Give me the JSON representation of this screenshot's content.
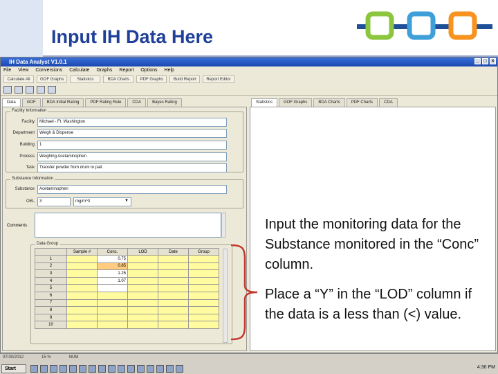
{
  "slide": {
    "title": "Input IH Data Here",
    "callout_1": "Input the monitoring data for the Substance monitored in the “Conc” column.",
    "callout_2": "Place a “Y” in the “LOD” column if the data is a less than (<) value."
  },
  "colors": {
    "title": "#1f3f99",
    "logo_green": "#8cc63f",
    "logo_blue": "#3f9fd8",
    "logo_orange": "#f7931e",
    "logo_bar": "#1f4f99",
    "brace": "#c0392b",
    "grid_yellow": "#fffb9e",
    "grid_selected": "#ffcc80"
  },
  "app": {
    "window_title": "IH Data Analyst V1.0.1",
    "menu": [
      "File",
      "View",
      "Conversions",
      "Calculate",
      "Graphs",
      "Report",
      "Options",
      "Help"
    ],
    "buttons": [
      "Calculate All",
      "GOF Graphs",
      "Statistics",
      "BDA Charts",
      "PDF Graphs",
      "Build Report",
      "Report Editor"
    ],
    "toolbar_icons": [
      "new-icon",
      "open-icon",
      "save-icon",
      "save-as-icon",
      "print-icon"
    ],
    "left_tabs": [
      "Data",
      "GOF",
      "BDA Initial Rating",
      "PDF Rating Rule",
      "CDA",
      "Bayes Rating"
    ],
    "right_tabs": [
      "Statistics",
      "GOF Graphs",
      "BDA Charts",
      "PDF Charts",
      "CDA"
    ],
    "facility_group": "Facility Information",
    "fields": [
      {
        "label": "Facility",
        "value": "Michael - Ft. Washington"
      },
      {
        "label": "Department",
        "value": "Weigh & Dispense"
      },
      {
        "label": "Building",
        "value": "1"
      },
      {
        "label": "Process",
        "value": "Weighing Acetaminophen"
      },
      {
        "label": "Task",
        "value": "Transfer powder from drum to pail."
      }
    ],
    "substance_group": "Substance Information",
    "substance": {
      "label": "Substance",
      "value": "Acetaminophen"
    },
    "oel": {
      "label": "OEL",
      "value": "3",
      "unit": "mg/m^3"
    },
    "comments_label": "Comments",
    "data_group": "Data Group",
    "grid": {
      "headers": [
        "",
        "Sample #",
        "Conc.",
        "LOD",
        "Date",
        "Group"
      ],
      "rows": [
        {
          "n": "1",
          "conc": "0.75"
        },
        {
          "n": "2",
          "conc": "0.85"
        },
        {
          "n": "3",
          "conc": "1.25"
        },
        {
          "n": "4",
          "conc": "1.07"
        },
        {
          "n": "5",
          "conc": ""
        },
        {
          "n": "6",
          "conc": ""
        },
        {
          "n": "7",
          "conc": ""
        },
        {
          "n": "8",
          "conc": ""
        },
        {
          "n": "9",
          "conc": ""
        },
        {
          "n": "10",
          "conc": ""
        }
      ]
    }
  },
  "taskbar": {
    "status": [
      "07/30/2012",
      "15 %",
      "NUM"
    ],
    "start": "Start",
    "clock": "4:30 PM"
  }
}
